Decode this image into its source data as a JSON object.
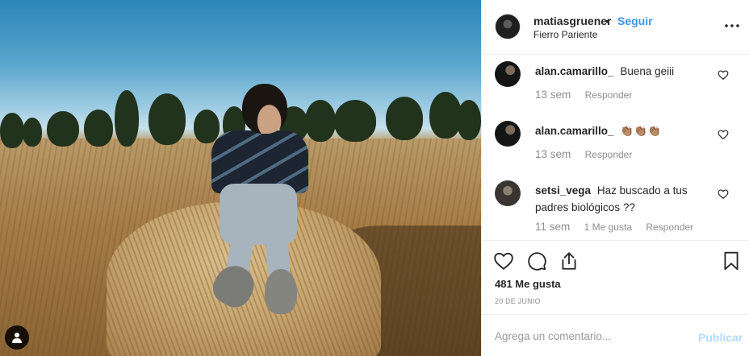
{
  "post": {
    "image_alt": "",
    "tag_icon": "user-tag-icon"
  },
  "header": {
    "username": "matiasgruener",
    "separator": "•",
    "follow_label": "Seguir",
    "location": "Fierro Pariente",
    "more_icon": "ellipsis-icon"
  },
  "comments": [
    {
      "username": "alan.camarillo_",
      "text": "Buena geiii",
      "time": "13 sem",
      "likes": "",
      "reply_label": "Responder"
    },
    {
      "username": "alan.camarillo_",
      "text": "👏🏽👏🏽👏🏽",
      "time": "13 sem",
      "likes": "",
      "reply_label": "Responder"
    },
    {
      "username": "setsi_vega",
      "text": "Haz buscado a tus padres biológicos ??",
      "time": "11 sem",
      "likes": "1 Me gusta",
      "reply_label": "Responder"
    }
  ],
  "actions": {
    "like_icon": "heart-icon",
    "comment_icon": "comment-bubble-icon",
    "share_icon": "share-icon",
    "save_icon": "bookmark-icon",
    "likes_text": "481 Me gusta",
    "date": "20 DE JUNIO"
  },
  "add_comment": {
    "placeholder": "Agrega un comentario...",
    "publish_label": "Publicar"
  },
  "colors": {
    "link_blue": "#3897f0",
    "publish_disabled": "#b3dbff",
    "meta_gray": "#8e8e8e",
    "divider": "#efefef"
  }
}
